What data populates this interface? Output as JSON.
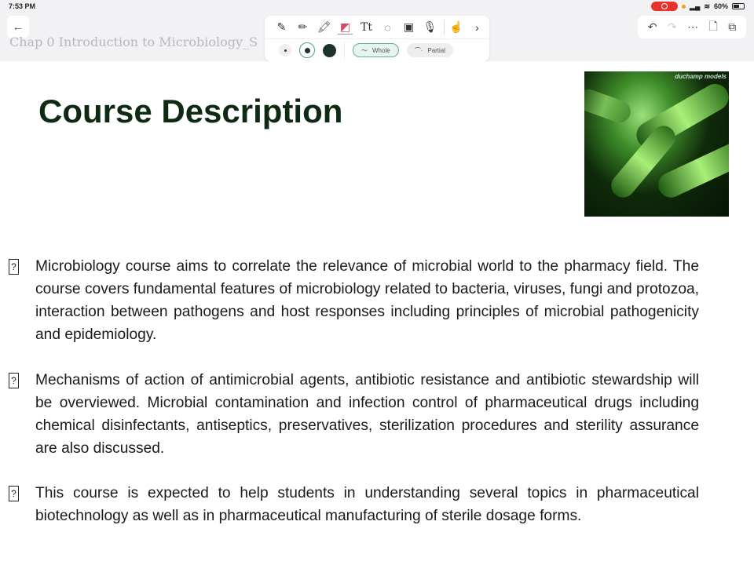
{
  "status": {
    "time": "7:53 PM",
    "battery": "60%"
  },
  "header": {
    "doc_title": "Chap 0 Introduction to Microbiology_S",
    "back_icon": "arrow-left-icon"
  },
  "toolbar": {
    "tools": [
      "pen",
      "pencil",
      "highlighter",
      "eraser",
      "text",
      "lasso",
      "image",
      "microphone",
      "hand"
    ],
    "active_tool": "eraser",
    "eraser_modes": {
      "whole": "Whole",
      "partial": "Partial"
    },
    "selected_mode": "Whole"
  },
  "slide": {
    "title": "Course Description",
    "image_watermark": "duchamp models",
    "bullet_glyph": "?",
    "paragraphs": [
      " Microbiology course aims to correlate the relevance of microbial world to the pharmacy field. The course covers fundamental features of microbiology related to bacteria, viruses, fungi and protozoa, interaction between pathogens and host responses including principles of microbial pathogenicity and epidemiology.",
      "Mechanisms of action of antimicrobial agents, antibiotic resistance and antibiotic stewardship will be overviewed. Microbial contamination and infection control of pharmaceutical drugs including chemical disinfectants, antiseptics, preservatives, sterilization procedures and sterility assurance are also discussed.",
      "This course is expected to help students in understanding several topics in pharmaceutical biotechnology as well as in pharmaceutical manufacturing of sterile dosage forms."
    ]
  }
}
